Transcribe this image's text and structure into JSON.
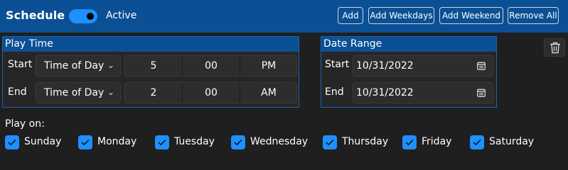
{
  "header": {
    "title": "Schedule",
    "toggle_label": "Active",
    "toggle_on": true,
    "buttons": {
      "add": "Add",
      "add_weekdays": "Add Weekdays",
      "add_weekend": "Add Weekend",
      "remove_all": "Remove All"
    }
  },
  "play_time": {
    "title": "Play Time",
    "start": {
      "label": "Start",
      "mode": "Time of Day",
      "hour": "5",
      "minute": "00",
      "period": "PM"
    },
    "end": {
      "label": "End",
      "mode": "Time of Day",
      "hour": "2",
      "minute": "00",
      "period": "AM"
    }
  },
  "date_range": {
    "title": "Date Range",
    "start": {
      "label": "Start",
      "value": "10/31/2022"
    },
    "end": {
      "label": "End",
      "value": "10/31/2022"
    }
  },
  "play_on": {
    "label": "Play on:",
    "days": [
      {
        "label": "Sunday",
        "checked": true
      },
      {
        "label": "Monday",
        "checked": true
      },
      {
        "label": "Tuesday",
        "checked": true
      },
      {
        "label": "Wednesday",
        "checked": true
      },
      {
        "label": "Thursday",
        "checked": true
      },
      {
        "label": "Friday",
        "checked": true
      },
      {
        "label": "Saturday",
        "checked": true
      }
    ]
  },
  "icons": {
    "toggle": "toggle-switch-icon",
    "chevron": "chevron-down-icon",
    "calendar": "calendar-icon",
    "delete": "trash-icon",
    "check": "checkmark-icon"
  },
  "colors": {
    "header_bg": "#0b4f94",
    "accent": "#1e90ff",
    "panel_border": "#1b66b0",
    "background": "#1f1f1f",
    "control_bg": "#2d2d2d"
  }
}
